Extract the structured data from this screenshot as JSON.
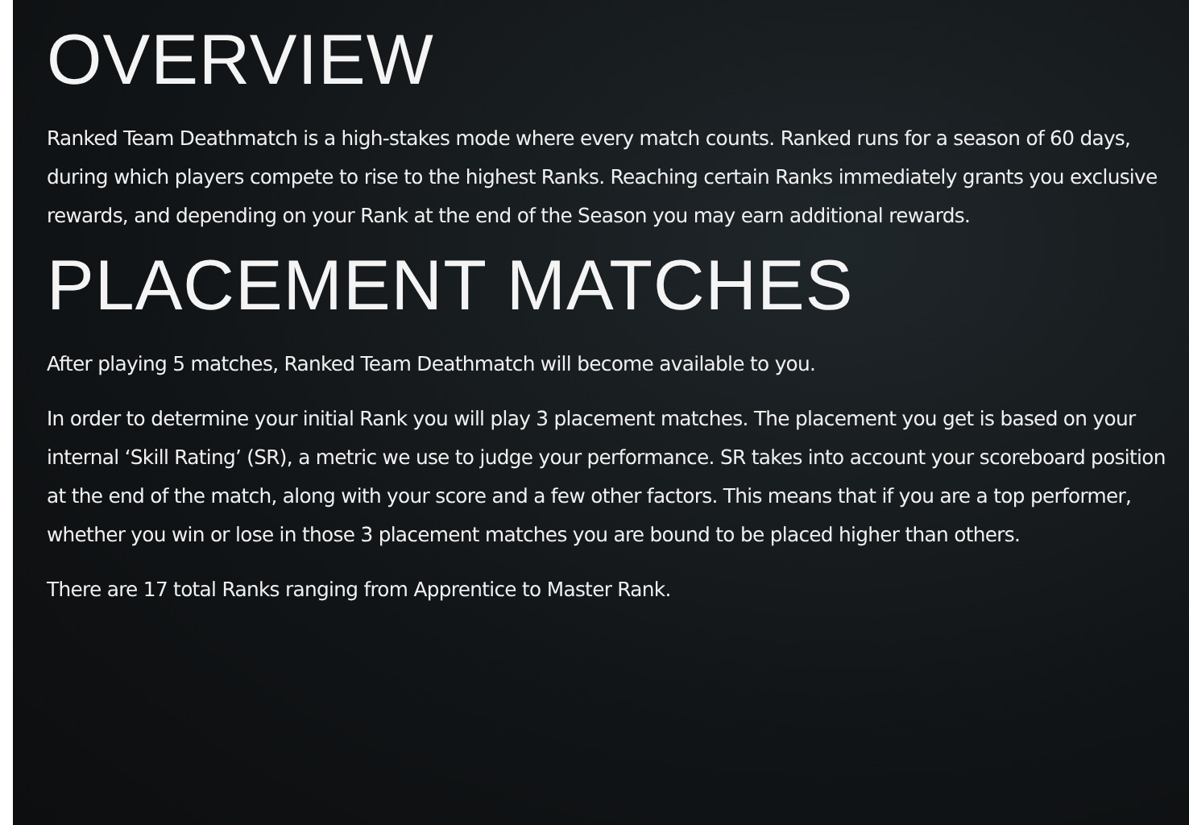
{
  "sections": [
    {
      "heading": "OVERVIEW",
      "paragraphs": [
        "Ranked Team Deathmatch is a high-stakes mode where every match counts. Ranked runs for a season of 60 days, during which players compete to rise to the highest Ranks. Reaching certain Ranks immediately grants you exclusive rewards, and depending on your Rank at the end of the Season you may earn additional rewards."
      ]
    },
    {
      "heading": "PLACEMENT MATCHES",
      "paragraphs": [
        "After playing 5 matches, Ranked Team Deathmatch will become available to you.",
        "In order to determine your initial Rank you will play 3 placement matches. The placement you get is based on your internal ‘Skill Rating’ (SR), a metric we use to judge your performance. SR takes into account your scoreboard position at the end of the match, along with your score and a few other factors. This means that if you are a top performer, whether you win or lose in those 3 placement matches you are bound to be placed higher than others.",
        "There are 17 total Ranks ranging from Apprentice to Master Rank."
      ]
    }
  ]
}
